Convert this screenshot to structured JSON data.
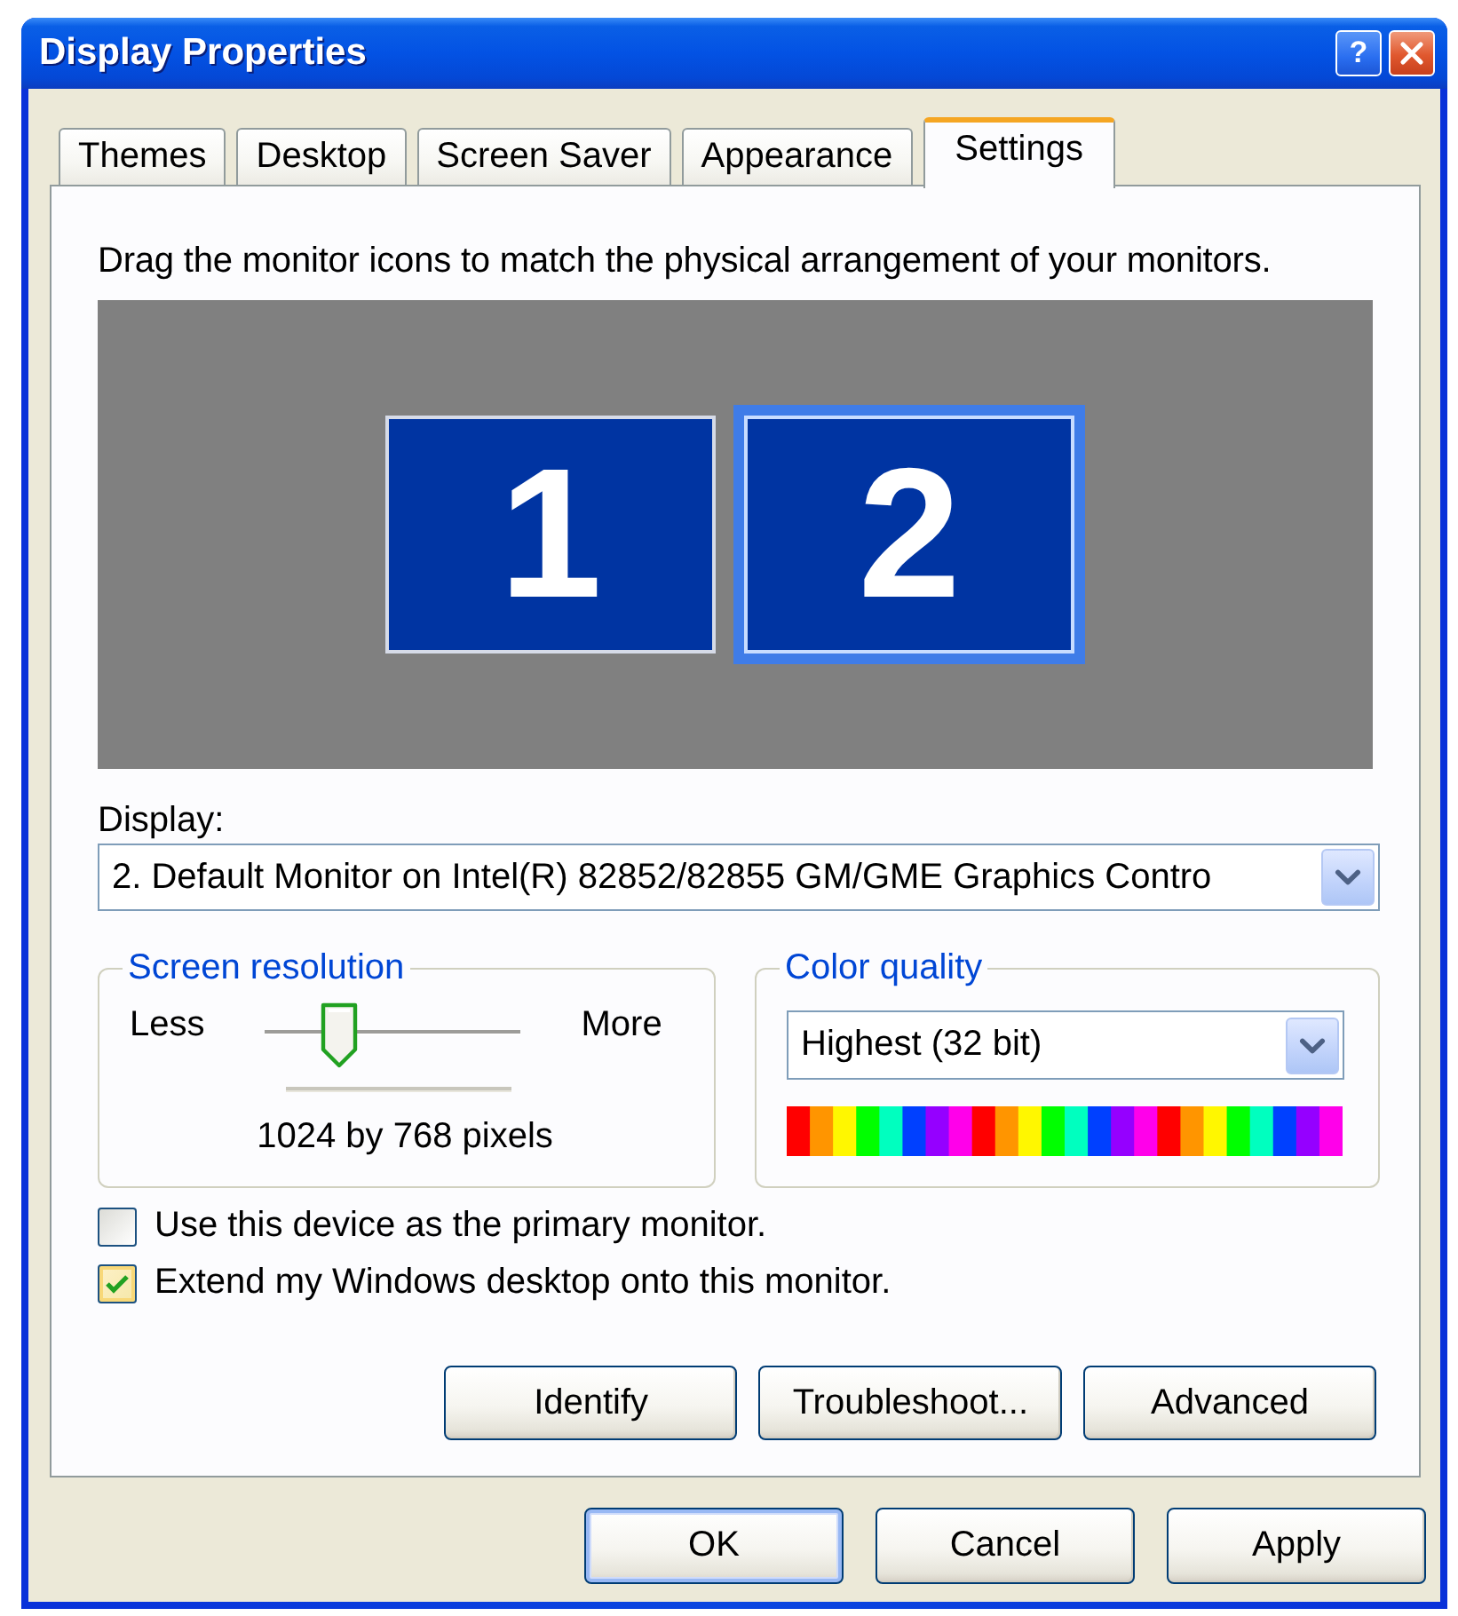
{
  "window": {
    "title": "Display Properties",
    "help_button": "?"
  },
  "tabs": [
    {
      "label": "Themes",
      "selected": false
    },
    {
      "label": "Desktop",
      "selected": false
    },
    {
      "label": "Screen Saver",
      "selected": false
    },
    {
      "label": "Appearance",
      "selected": false
    },
    {
      "label": "Settings",
      "selected": true
    }
  ],
  "instruction": "Drag the monitor icons to match the physical arrangement of your monitors.",
  "monitors": [
    {
      "label": "1",
      "selected": false
    },
    {
      "label": "2",
      "selected": true
    }
  ],
  "display": {
    "label": "Display:",
    "value": "2. Default Monitor on Intel(R) 82852/82855 GM/GME Graphics Contro"
  },
  "screen_resolution": {
    "title": "Screen resolution",
    "min_label": "Less",
    "max_label": "More",
    "level": 0.25,
    "reading": "1024 by 768 pixels"
  },
  "color_quality": {
    "title": "Color quality",
    "value": "Highest (32 bit)"
  },
  "checkboxes": [
    {
      "label": "Use this device as the primary monitor.",
      "checked": false
    },
    {
      "label": "Extend my Windows desktop onto this monitor.",
      "checked": true
    }
  ],
  "panel_buttons": [
    "Identify",
    "Troubleshoot...",
    "Advanced"
  ],
  "dialog_buttons": [
    {
      "label": "OK",
      "default": true
    },
    {
      "label": "Cancel",
      "default": false
    },
    {
      "label": "Apply",
      "default": false
    }
  ]
}
